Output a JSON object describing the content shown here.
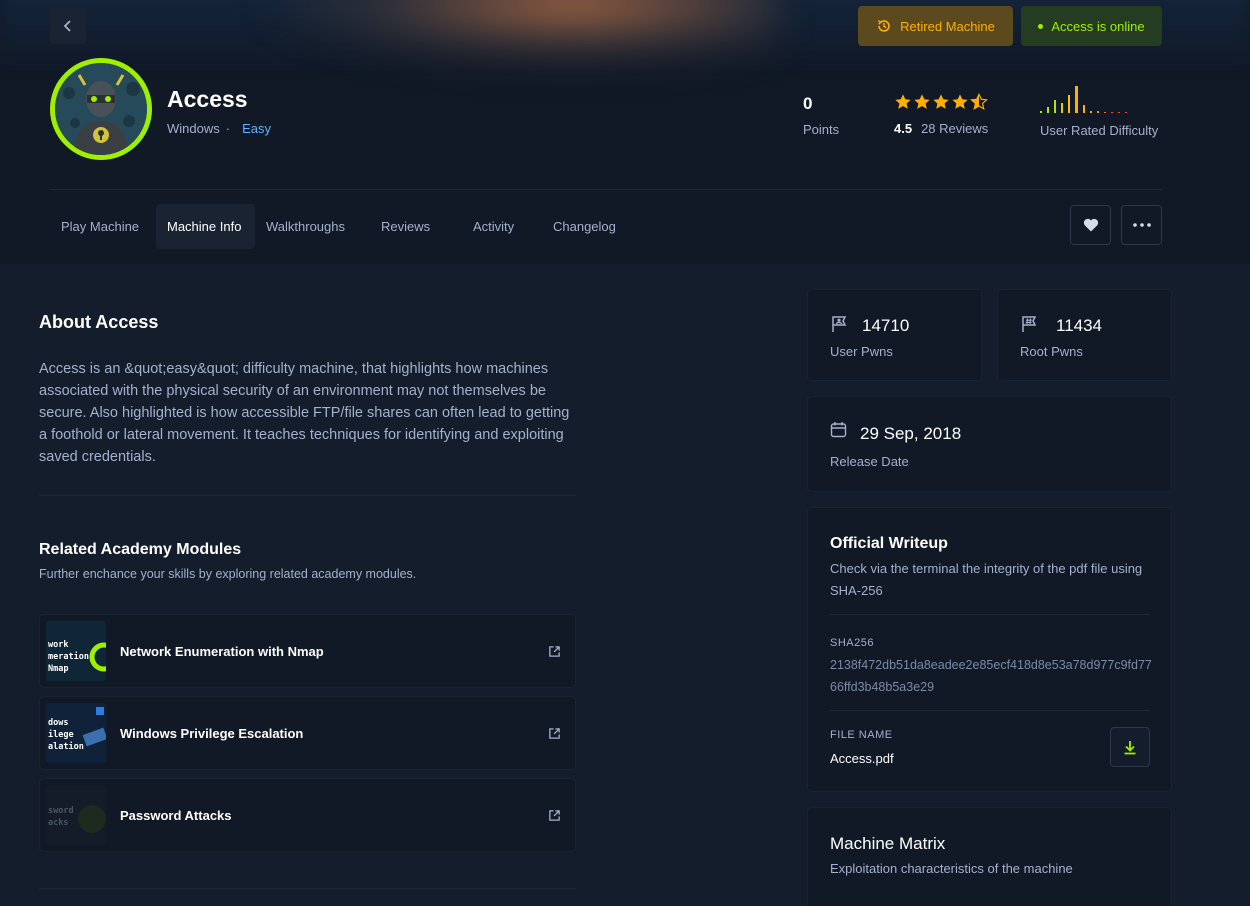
{
  "header": {
    "retired_label": "Retired Machine",
    "online_label": "Access is online"
  },
  "machine": {
    "name": "Access",
    "os": "Windows",
    "separator": "·",
    "difficulty": "Easy",
    "points": "0",
    "points_label": "Points",
    "rating": "4.5",
    "reviews": "28 Reviews",
    "difficulty_label": "User Rated Difficulty"
  },
  "tabs": [
    {
      "label": "Play Machine"
    },
    {
      "label": "Machine Info"
    },
    {
      "label": "Walkthroughs"
    },
    {
      "label": "Reviews"
    },
    {
      "label": "Activity"
    },
    {
      "label": "Changelog"
    }
  ],
  "about": {
    "title": "About Access",
    "text": "Access is an &quot;easy&quot; difficulty machine, that highlights how machines associated with the physical security of an environment may not themselves be secure. Also highlighted is how accessible FTP/file shares can often lead to getting a foothold or lateral movement. It teaches techniques for identifying and exploiting saved credentials."
  },
  "related": {
    "title": "Related Academy Modules",
    "subtitle": "Further enchance your skills by exploring related academy modules.",
    "modules": [
      {
        "name": "Network Enumeration with Nmap",
        "thumb": [
          "work",
          "meration",
          "Nmap"
        ]
      },
      {
        "name": "Windows Privilege Escalation",
        "thumb": [
          "dows",
          "ilege",
          "alation"
        ]
      },
      {
        "name": "Password Attacks",
        "thumb": [
          "sword",
          "acks"
        ]
      }
    ]
  },
  "stats": {
    "user_pwns": "14710",
    "user_pwns_label": "User Pwns",
    "root_pwns": "11434",
    "root_pwns_label": "Root Pwns",
    "release_date": "29 Sep, 2018",
    "release_label": "Release Date"
  },
  "writeup": {
    "title": "Official Writeup",
    "description": "Check via the terminal the integrity of the pdf file using SHA-256",
    "sha_label": "SHA256",
    "sha_value": "2138f472db51da8eadee2e85ecf418d8e53a78d977c9fd7766ffd3b48b5a3e29",
    "file_label": "FILE NAME",
    "file_name": "Access.pdf"
  },
  "matrix": {
    "title": "Machine Matrix",
    "subtitle": "Exploitation characteristics of the machine",
    "peek_label": ""
  },
  "colors": {
    "background": "#141d2b",
    "panel": "#111927",
    "accent_green": "#9fef00",
    "accent_orange": "#ffaf00",
    "link_blue": "#5cb2ff"
  },
  "icons": {
    "back": "chevron-left-icon",
    "retired": "history-icon",
    "favorite": "heart-icon",
    "more": "ellipsis-icon",
    "external": "external-link-icon",
    "download": "download-icon",
    "calendar": "calendar-icon"
  }
}
